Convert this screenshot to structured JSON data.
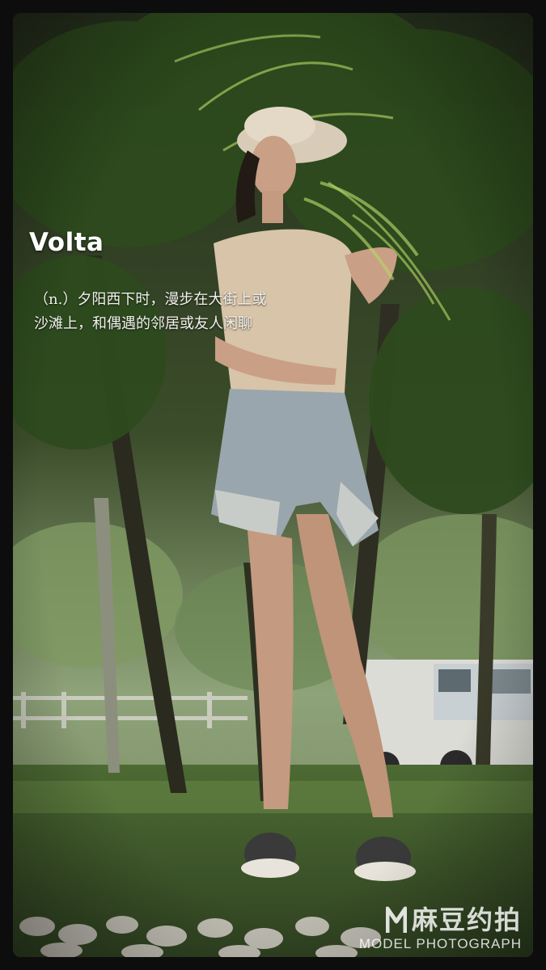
{
  "poster": {
    "title": "Volta",
    "definition_line1": "（n.）夕阳西下时，漫步在大街上或",
    "definition_line2": "沙滩上，和偶遇的邻居或友人闲聊"
  },
  "watermark": {
    "logo_icon": "m-logo-icon",
    "cn_text": "麻豆约拍",
    "en_text": "MODEL PHOTOGRAPH"
  },
  "colors": {
    "border": "#0d0d0d",
    "foliage": "#3f5530",
    "text": "#ffffff"
  }
}
